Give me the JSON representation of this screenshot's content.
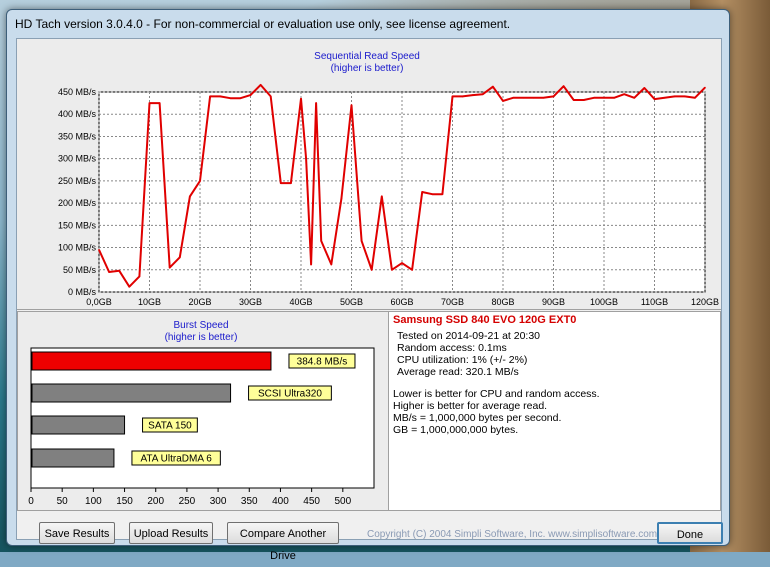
{
  "window": {
    "title": "HD Tach version 3.0.4.0  - For non-commercial or evaluation use only, see license agreement."
  },
  "sequential": {
    "title": "Sequential Read Speed",
    "subtitle": "(higher is better)"
  },
  "burst": {
    "title": "Burst Speed",
    "subtitle": "(higher is better)"
  },
  "info": {
    "drive": "Samsung SSD 840 EVO 120G EXT0",
    "tested": "Tested on 2014-09-21 at 20:30",
    "random_access": "Random access: 0.1ms",
    "cpu": "CPU utilization: 1% (+/- 2%)",
    "average": "Average read: 320.1 MB/s",
    "note1": "Lower is better for CPU and random access.",
    "note2": "Higher is better for average read.",
    "note3": "MB/s = 1,000,000 bytes per second.",
    "note4": "GB = 1,000,000,000 bytes."
  },
  "buttons": {
    "save": "Save Results",
    "upload": "Upload Results",
    "compare": "Compare Another Drive",
    "done": "Done"
  },
  "copyright": "Copyright (C) 2004 Simpli Software, Inc. www.simplisoftware.com",
  "colors": {
    "line": "#e00000",
    "red_bar": "#ee0000",
    "gray_bar": "#808080",
    "label_bg": "#ffff99",
    "title_blue": "#1a1acc"
  },
  "chart_data": [
    {
      "type": "line",
      "title": "Sequential Read Speed",
      "subtitle": "(higher is better)",
      "xlim": [
        0,
        120
      ],
      "ylim": [
        0,
        450
      ],
      "xticks": [
        0,
        10,
        20,
        30,
        40,
        50,
        60,
        70,
        80,
        90,
        100,
        110,
        120
      ],
      "xtick_labels": [
        "0,0GB",
        "10GB",
        "20GB",
        "30GB",
        "40GB",
        "50GB",
        "60GB",
        "70GB",
        "80GB",
        "90GB",
        "100GB",
        "110GB",
        "120GB"
      ],
      "yticks": [
        0,
        50,
        100,
        150,
        200,
        250,
        300,
        350,
        400,
        450
      ],
      "ytick_labels": [
        "0 MB/s",
        "50 MB/s",
        "100 MB/s",
        "150 MB/s",
        "200 MB/s",
        "250 MB/s",
        "300 MB/s",
        "350 MB/s",
        "400 MB/s",
        "450 MB/s"
      ],
      "grid": true,
      "series": [
        {
          "x": [
            0,
            2,
            4,
            6,
            8,
            10,
            12,
            14,
            16,
            18,
            20,
            22,
            24,
            26,
            28,
            30,
            32,
            34,
            36,
            38,
            40,
            41,
            42,
            43,
            44,
            46,
            48,
            50,
            52,
            54,
            56,
            58,
            60,
            62,
            64,
            66,
            68,
            70,
            72,
            74,
            76,
            78,
            80,
            82,
            84,
            86,
            88,
            90,
            92,
            94,
            96,
            98,
            100,
            102,
            104,
            106,
            108,
            110,
            112,
            114,
            116,
            118,
            120
          ],
          "y": [
            95,
            45,
            48,
            12,
            35,
            425,
            425,
            55,
            78,
            215,
            250,
            440,
            440,
            436,
            436,
            443,
            466,
            440,
            245,
            245,
            435,
            300,
            62,
            425,
            115,
            62,
            210,
            420,
            115,
            50,
            215,
            50,
            65,
            50,
            225,
            220,
            220,
            440,
            440,
            443,
            445,
            462,
            430,
            437,
            437,
            437,
            437,
            440,
            463,
            432,
            432,
            437,
            437,
            437,
            445,
            437,
            459,
            434,
            437,
            440,
            440,
            437,
            460
          ]
        }
      ]
    },
    {
      "type": "bar",
      "orientation": "horizontal",
      "title": "Burst Speed",
      "subtitle": "(higher is better)",
      "xlim": [
        0,
        550
      ],
      "xticks": [
        0,
        50,
        100,
        150,
        200,
        250,
        300,
        350,
        400,
        450,
        500
      ],
      "bars": [
        {
          "value": 384.8,
          "label": "384.8 MB/s",
          "color": "#ee0000"
        },
        {
          "value": 320,
          "label": "SCSI Ultra320",
          "color": "#808080"
        },
        {
          "value": 150,
          "label": "SATA 150",
          "color": "#808080"
        },
        {
          "value": 133,
          "label": "ATA UltraDMA 6",
          "color": "#808080"
        }
      ]
    }
  ]
}
